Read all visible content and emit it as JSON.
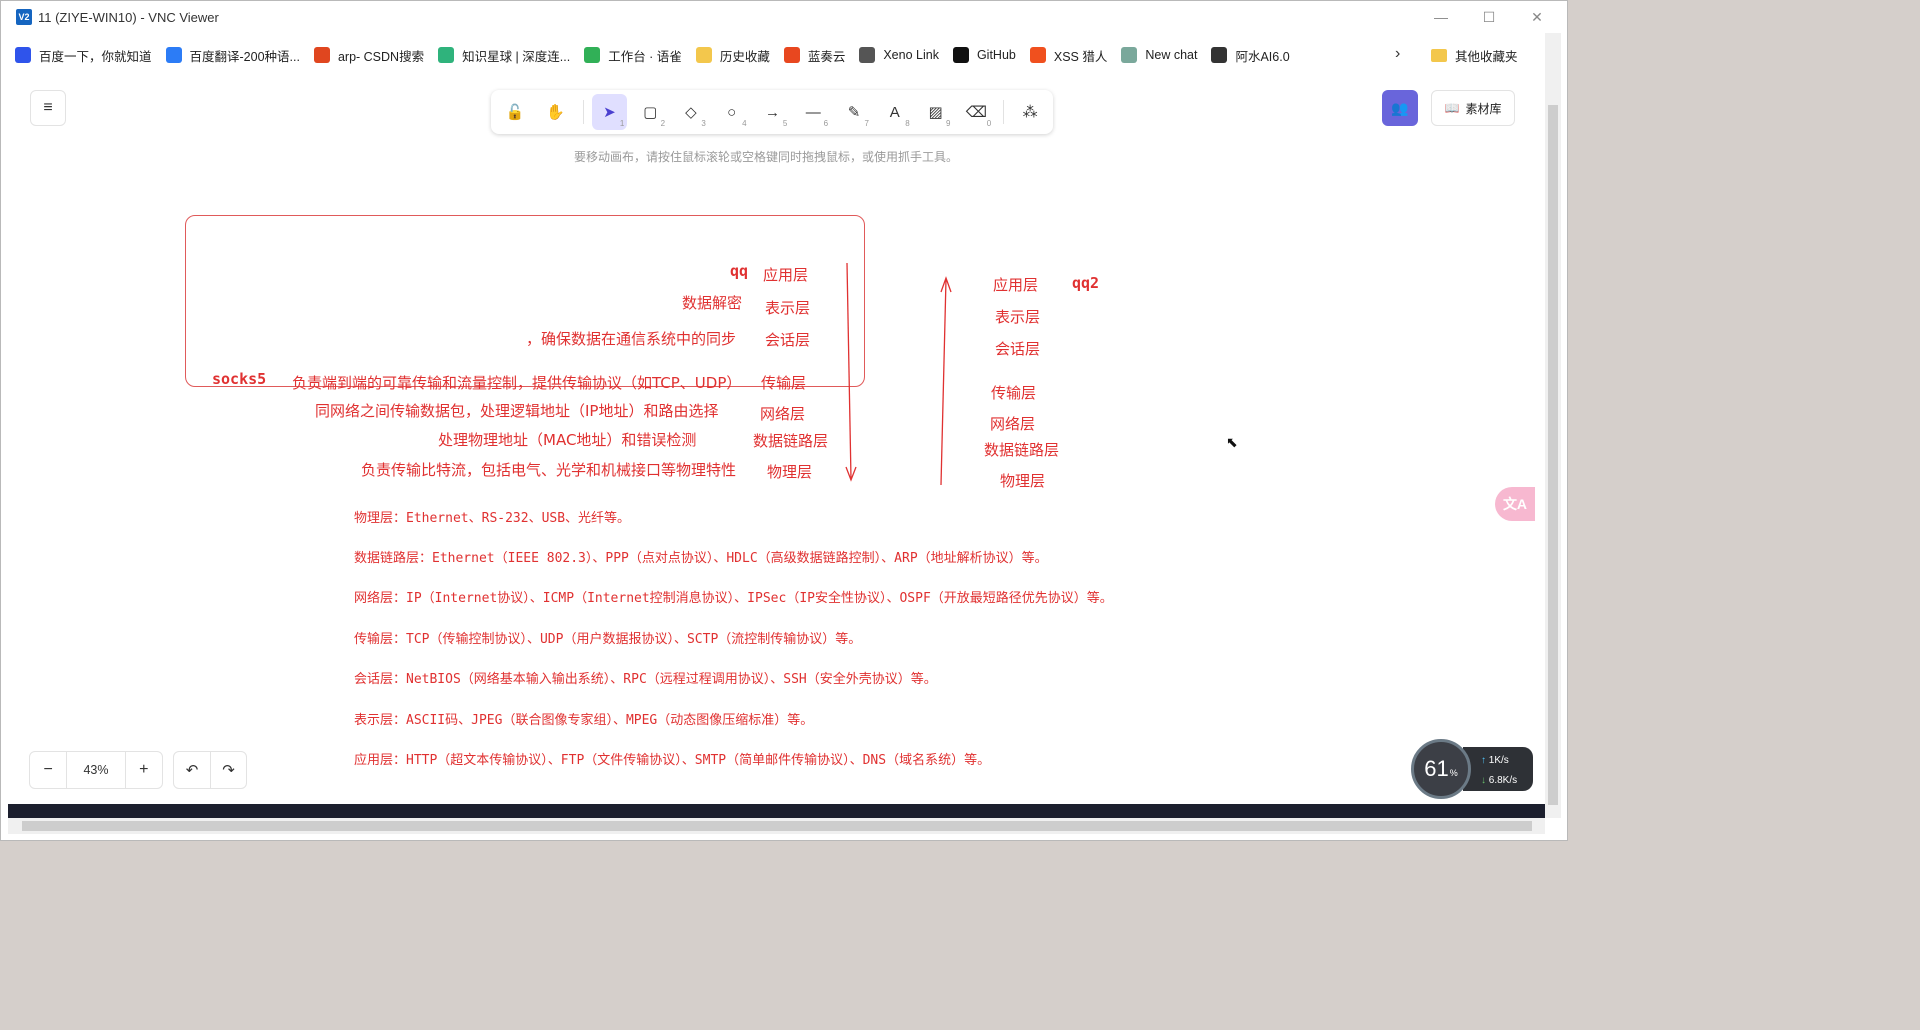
{
  "window": {
    "logo_text": "V2",
    "title": "11 (ZIYE-WIN10) - VNC Viewer",
    "minimize_icon": "minimize-icon",
    "maximize_icon": "maximize-icon",
    "close_icon": "close-icon"
  },
  "bookmarks": {
    "items": [
      {
        "label": "百度一下，你就知道",
        "icon": "baidu-icon",
        "color": "#2f54eb"
      },
      {
        "label": "百度翻译-200种语...",
        "icon": "baidu-translate-icon",
        "color": "#2c7cf6"
      },
      {
        "label": "arp- CSDN搜索",
        "icon": "csdn-icon",
        "color": "#e0461f"
      },
      {
        "label": "知识星球 | 深度连...",
        "icon": "zsxq-icon",
        "color": "#2fb37c"
      },
      {
        "label": "工作台 · 语雀",
        "icon": "yuque-icon",
        "color": "#31b057"
      },
      {
        "label": "历史收藏",
        "icon": "folder-icon",
        "color": "#f3c74c"
      },
      {
        "label": "蓝奏云",
        "icon": "lanzou-icon",
        "color": "#e8471f"
      },
      {
        "label": "Xeno Link",
        "icon": "file-icon",
        "color": "#555555"
      },
      {
        "label": "GitHub",
        "icon": "github-icon",
        "color": "#111111"
      },
      {
        "label": "XSS 猎人",
        "icon": "fire-icon",
        "color": "#f0501e"
      },
      {
        "label": "New chat",
        "icon": "openai-icon",
        "color": "#7aa89b"
      },
      {
        "label": "阿水AI6.0",
        "icon": "chat-icon",
        "color": "#333333"
      }
    ],
    "more_icon": "chevron-right-icon",
    "other_label": "其他收藏夹"
  },
  "toolbar": {
    "tools": [
      {
        "name": "lock-tool",
        "glyph": "🔓",
        "num": ""
      },
      {
        "name": "hand-tool",
        "glyph": "✋",
        "num": ""
      },
      {
        "name": "selection-tool",
        "glyph": "➤",
        "num": "1"
      },
      {
        "name": "rectangle-tool",
        "glyph": "▢",
        "num": "2"
      },
      {
        "name": "diamond-tool",
        "glyph": "◇",
        "num": "3"
      },
      {
        "name": "ellipse-tool",
        "glyph": "○",
        "num": "4"
      },
      {
        "name": "arrow-tool",
        "glyph": "→",
        "num": "5"
      },
      {
        "name": "line-tool",
        "glyph": "—",
        "num": "6"
      },
      {
        "name": "draw-tool",
        "glyph": "✎",
        "num": "7"
      },
      {
        "name": "text-tool",
        "glyph": "A",
        "num": "8"
      },
      {
        "name": "image-tool",
        "glyph": "▨",
        "num": "9"
      },
      {
        "name": "eraser-tool",
        "glyph": "⌫",
        "num": "0"
      },
      {
        "name": "extra-tools",
        "glyph": "⁂",
        "num": ""
      }
    ],
    "active_tool": "selection-tool"
  },
  "header": {
    "menu_icon": "hamburger-icon",
    "library_label": "素材库",
    "hint": "要移动画布，请按住鼠标滚轮或空格键同时拖拽鼠标，或使用抓手工具。"
  },
  "diagram": {
    "left_column": {
      "app": "qq",
      "socks": "socks5",
      "layers": [
        "应用层",
        "表示层",
        "会话层",
        "传输层",
        "网络层",
        "数据链路层",
        "物理层"
      ],
      "descriptions": {
        "presentation": "数据解密",
        "session": "，确保数据在通信系统中的同步",
        "transport": "负责端到端的可靠传输和流量控制，提供传输协议（如TCP、UDP）",
        "network": "同网络之间传输数据包，处理逻辑地址（IP地址）和路由选择",
        "datalink": "处理物理地址（MAC地址）和错误检测",
        "physical": "负责传输比特流，包括电气、光学和机械接口等物理特性"
      }
    },
    "right_column": {
      "app": "qq2",
      "layers": [
        "应用层",
        "表示层",
        "会话层",
        "传输层",
        "网络层",
        "数据链路层",
        "物理层"
      ]
    },
    "notes": [
      "物理层：Ethernet、RS-232、USB、光纤等。",
      "数据链路层：Ethernet（IEEE 802.3）、PPP（点对点协议）、HDLC（高级数据链路控制）、ARP（地址解析协议）等。",
      "网络层：IP（Internet协议）、ICMP（Internet控制消息协议）、IPSec（IP安全性协议）、OSPF（开放最短路径优先协议）等。",
      "传输层：TCP（传输控制协议）、UDP（用户数据报协议）、SCTP（流控制传输协议）等。",
      "会话层：NetBIOS（网络基本输入输出系统）、RPC（远程过程调用协议）、SSH（安全外壳协议）等。",
      "表示层：ASCII码、JPEG（联合图像专家组）、MPEG（动态图像压缩标准）等。",
      "应用层：HTTP（超文本传输协议）、FTP（文件传输协议）、SMTP（简单邮件传输协议）、DNS（域名系统）等。"
    ],
    "stroke_color": "#e03131"
  },
  "footer": {
    "zoom_out": "−",
    "zoom_value": "43%",
    "zoom_in": "+",
    "undo_icon": "undo-icon",
    "redo_icon": "redo-icon",
    "translate_label": "文A"
  },
  "net_monitor": {
    "percent": "61",
    "percent_unit": "%",
    "upload": "1K/s",
    "download": "6.8K/s"
  }
}
